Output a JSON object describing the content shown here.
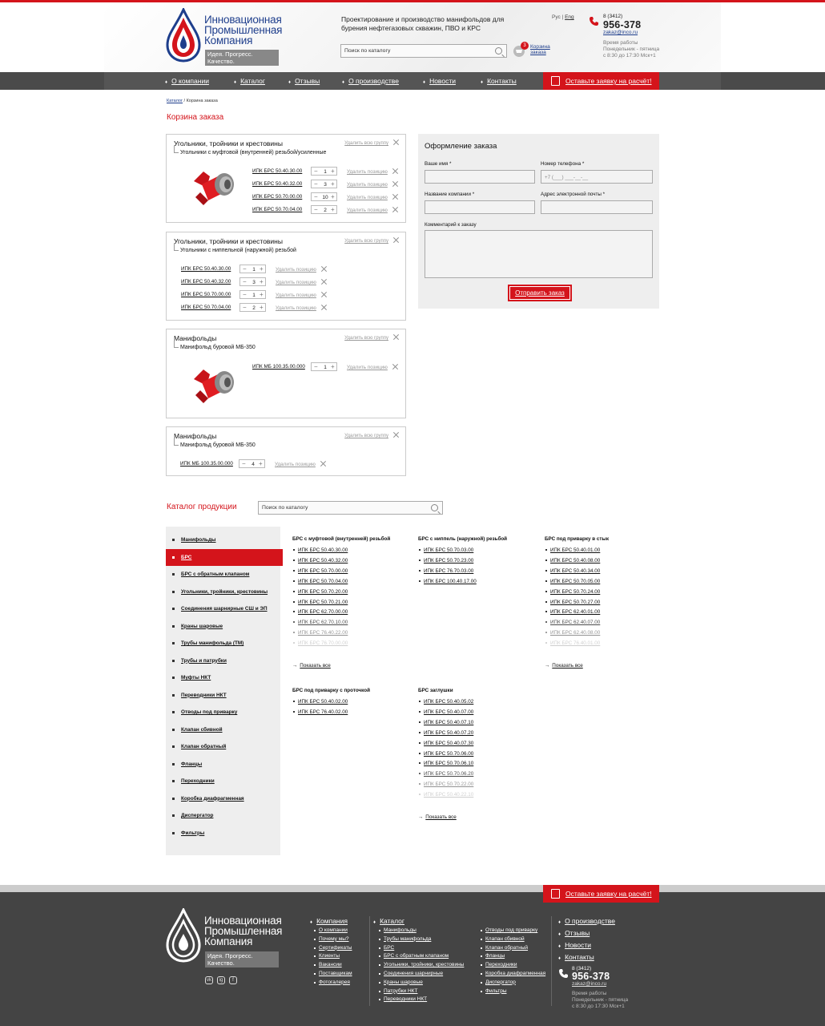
{
  "brand": {
    "name_line1": "Инновационная",
    "name_line2": "Промышленная",
    "name_line3": "Компания",
    "slogan": "Идея. Прогресс. Качество.",
    "tagline": "Проектирование и производство манифольдов для бурения нефтегазовых скважин, ПВО и КРС",
    "colors": {
      "red": "#d4141b",
      "blue": "#1e3e8c"
    }
  },
  "header": {
    "search_placeholder": "Поиск по каталогу",
    "cart_count": "3",
    "cart_label": "Корзина заказа",
    "lang_ru": "Рус",
    "lang_sep": "|",
    "lang_en": "Eng",
    "phone_code": "8 (3412)",
    "phone": "956-378",
    "email": "zakaz@inco.ru",
    "hours_title": "Время работы",
    "hours_days": "Понедельник - пятница",
    "hours_time": "с 8:30 до 17:30 Мск+1"
  },
  "nav": {
    "items": [
      "О компании",
      "Каталог",
      "Отзывы",
      "О производстве",
      "Новости",
      "Контакты"
    ],
    "cta": "Оставьте заявку на расчёт!"
  },
  "breadcrumb": {
    "catalog": "Каталог",
    "sep": "/",
    "current": "Корзина заказа"
  },
  "page_title": "Корзина заказа",
  "cart": {
    "del_group": "Удалить всю группу",
    "del_pos": "Удалить позицию",
    "groups": [
      {
        "title": "Угольники, тройники и крестовины",
        "sub": "Угольники с муфтовой (внутренней) резьбой/усиленные",
        "items": [
          {
            "code": "ИПК БРС 50.40.30.00",
            "qty": "1"
          },
          {
            "code": "ИПК БРС 50.40.32.00",
            "qty": "3"
          },
          {
            "code": "ИПК БРС 50.70.00.00",
            "qty": "10"
          },
          {
            "code": "ИПК БРС 50.70.04.00",
            "qty": "2"
          }
        ]
      },
      {
        "title": "Угольники, тройники и крестовины",
        "sub": "Угольники с ниппельной (наружной) резьбой",
        "items": [
          {
            "code": "ИПК БРС 50.40.30.00",
            "qty": "1"
          },
          {
            "code": "ИПК БРС 50.40.32.00",
            "qty": "3"
          },
          {
            "code": "ИПК БРС 50.70.00.00",
            "qty": "1"
          },
          {
            "code": "ИПК БРС 50.70.04.00",
            "qty": "2"
          }
        ]
      },
      {
        "title": "Манифольды",
        "sub": "Манифольд буровой МБ-350",
        "items": [
          {
            "code": "ИПК МБ 100.35.00.000",
            "qty": "1"
          }
        ]
      },
      {
        "title": "Манифольды",
        "sub": "Манифольд буровой МБ-350",
        "items": [
          {
            "code": "ИПК МБ 100.35.00.000",
            "qty": "4"
          }
        ]
      }
    ]
  },
  "order_form": {
    "title": "Оформление заказа",
    "name_label": "Ваше имя *",
    "phone_label": "Номер телефона *",
    "phone_placeholder": "+7 (___) ___-__-__",
    "company_label": "Название компании *",
    "email_label": "Адрес электронной почты *",
    "comment_label": "Комментарий к заказу",
    "submit": "Отправить заказ"
  },
  "catalog": {
    "title": "Каталог продукции",
    "search_placeholder": "Поиск по каталогу",
    "show_all": "Показать все",
    "sidebar": [
      "Манифольды",
      "БРС",
      "БРС с обратным клапаном",
      "Угольники, тройники, крестовины",
      "Соединения шарнирные СШ и ЭП",
      "Краны шаровые",
      "Трубы манифольда (ТМ)",
      "Трубы и патрубки",
      "Муфты НКТ",
      "Переводники НКТ",
      "Отводы под приварку",
      "Клапан сбивной",
      "Клапан обратный",
      "Фланцы",
      "Переходники",
      "Коробка диафрагменная",
      "Диспергатор",
      "Фильтры"
    ],
    "columns": [
      {
        "title": "БРС с муфтовой (внутренней) резьбой",
        "items": [
          "ИПК БРС 50.40.30.00",
          "ИПК БРС 50.40.32.00",
          "ИПК БРС 50.70.00.00",
          "ИПК БРС 50.70.04.00",
          "ИПК БРС 50.70.20.00",
          "ИПК БРС 50.70.21.00",
          "ИПК БРС 62.70.00.00",
          "ИПК БРС 62.70.10.00",
          "ИПК БРС 76.40.22.00",
          "ИПК БРС 76.70.00.00"
        ]
      },
      {
        "title": "БРС с ниппель (наружной) резьбой",
        "items": [
          "ИПК БРС 50.70.03.00",
          "ИПК БРС 50.70.23.00",
          "ИПК БРС 76.70.03.00",
          "ИПК БРС 100.40.17.00"
        ]
      },
      {
        "title": "БРС под приварку в стык",
        "items": [
          "ИПК БРС 50.40.01.00",
          "ИПК БРС 50.40.08.00",
          "ИПК БРС 50.40.34.00",
          "ИПК БРС 50.70.05.00",
          "ИПК БРС 50.70.24.00",
          "ИПК БРС 50.70.27.00",
          "ИПК БРС 62.40.01.00",
          "ИПК БРС 62.40.07.00",
          "ИПК БРС 62.40.08.00",
          "ИПК БРС 76.40.01.00"
        ]
      },
      {
        "title": "БРС под приварку с проточкой",
        "items": [
          "ИПК БРС 50.40.02.00",
          "ИПК БРС 76.40.02.00"
        ]
      },
      {
        "title": "БРС заглушки",
        "items": [
          "ИПК БРС 50.40.05.02",
          "ИПК БРС 50.40.07.00",
          "ИПК БРС 50.40.07.10",
          "ИПК БРС 50.40.07.20",
          "ИПК БРС 50.40.07.30",
          "ИПК БРС 50.70.06.00",
          "ИПК БРС 50.70.06.10",
          "ИПК БРС 50.70.06.20",
          "ИПК БРС 50.70.22.00",
          "ИПК БРС 50.40.22.10"
        ]
      }
    ]
  },
  "footer": {
    "cta": "Оставьте заявку на расчёт!",
    "col1_title": "Компания",
    "col1": [
      "О компании",
      "Почему мы?",
      "Сертификаты",
      "Клиенты",
      "Вакансии",
      "Поставщикам",
      "Фотогалерея"
    ],
    "col2_title": "Каталог",
    "col2a": [
      "Манифольды",
      "Трубы манифольда",
      "БРС",
      "БРС с обратным клапаном",
      "Угольники, тройники, крестовины",
      "Соединения шарнирные",
      "Краны шаровые",
      "Патрубки НКТ",
      "Переводники НКТ"
    ],
    "col2b": [
      "Отводы под приварку",
      "Клапан сбивной",
      "Клапан обратный",
      "Фланцы",
      "Переходники",
      "Коробка диафрагменная",
      "Диспергатор",
      "Фильтры"
    ],
    "col3": [
      "О производстве",
      "Отзывы",
      "Новости",
      "Контакты"
    ],
    "social": [
      "vk",
      "ig",
      "f"
    ]
  }
}
